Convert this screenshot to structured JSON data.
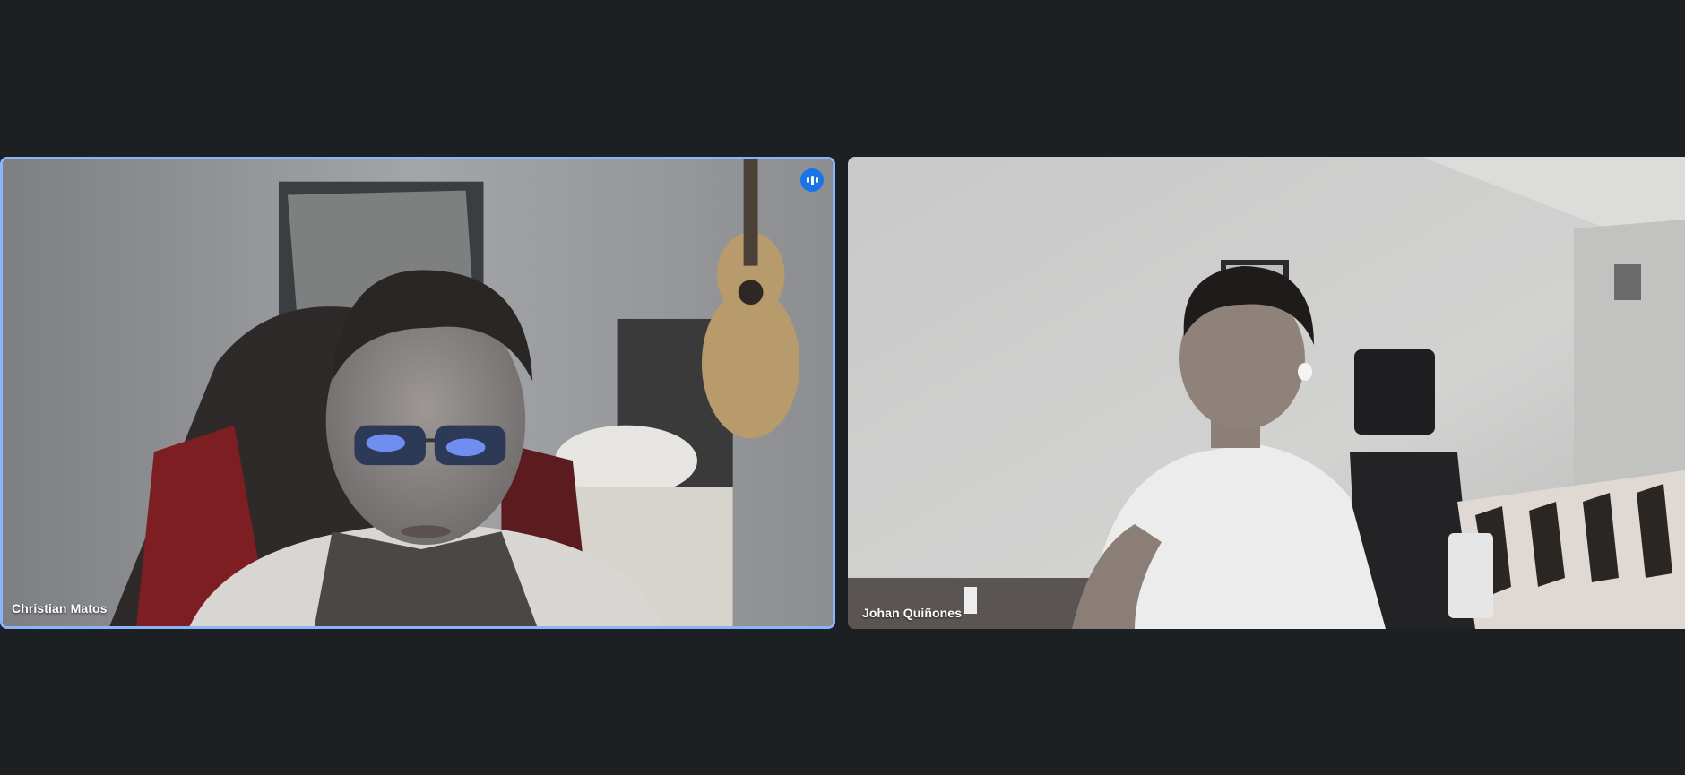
{
  "participants": [
    {
      "name": "Christian Matos",
      "speaking": true,
      "icon": "speaking-audio-bars-icon"
    },
    {
      "name": "Johan Quiñones",
      "speaking": false
    }
  ],
  "colors": {
    "background": "#1c2023",
    "active_speaker_border": "#8ab4f8",
    "speaking_badge": "#1a73e8"
  }
}
